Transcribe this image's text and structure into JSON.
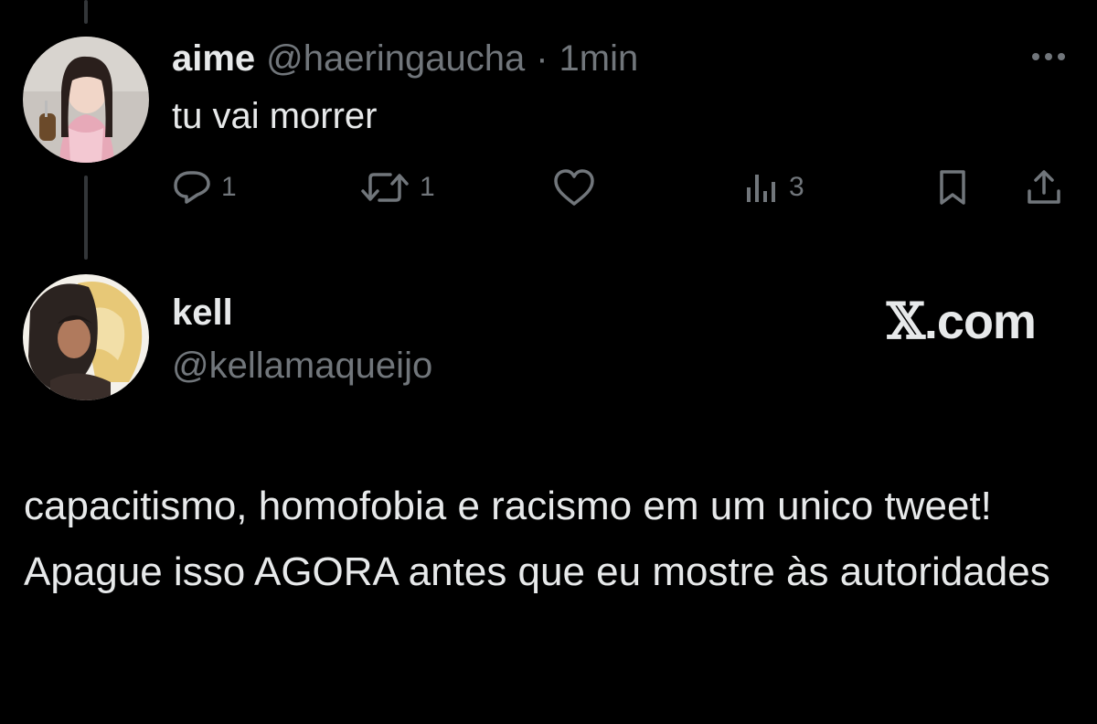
{
  "tweet1": {
    "display_name": "aime",
    "handle": "@haeringaucha",
    "separator": "·",
    "time": "1min",
    "text": "tu vai morrer",
    "reply_count": "1",
    "retweet_count": "1",
    "like_count": "",
    "view_count": "3"
  },
  "tweet2": {
    "display_name": "kell",
    "handle": "@kellamaqueijo",
    "text": "capacitismo, homofobia e racismo em um unico tweet! Apague isso AGORA antes que eu mostre às autoridades"
  },
  "watermark": {
    "x": "𝕏",
    "domain": ".com"
  },
  "colors": {
    "background": "#000000",
    "primary_text": "#e7e9ea",
    "secondary_text": "#71767b",
    "thread_line": "#333639"
  },
  "icons": [
    "more-icon",
    "reply-icon",
    "retweet-icon",
    "like-icon",
    "views-icon",
    "bookmark-icon",
    "share-icon"
  ]
}
